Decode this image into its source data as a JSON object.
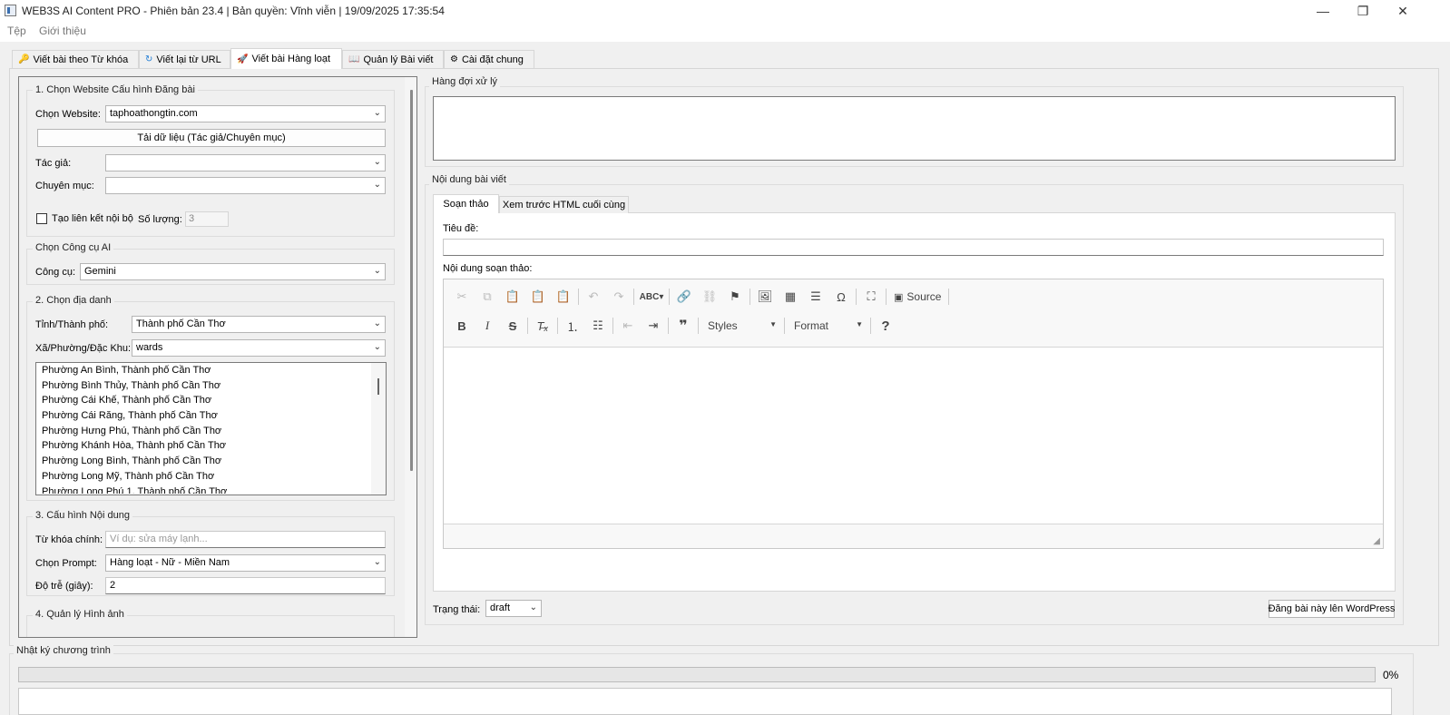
{
  "window": {
    "title": "WEB3S AI Content PRO - Phiên bản 23.4  |  Bản quyền: Vĩnh viễn  |  19/09/2025 17:35:54",
    "minimize": "—",
    "maximize": "❐",
    "close": "✕"
  },
  "menu": {
    "items": [
      "Tệp",
      "Giới thiệu"
    ]
  },
  "tabs": [
    {
      "icon": "🔑",
      "label": "Viết bài theo Từ khóa"
    },
    {
      "icon": "↻",
      "label": "Viết lại từ URL"
    },
    {
      "icon": "🚀",
      "label": "Viết bài Hàng loạt"
    },
    {
      "icon": "📖",
      "label": "Quản lý Bài viết"
    },
    {
      "icon": "⚙",
      "label": "Cài đặt chung"
    }
  ],
  "left": {
    "website_group": {
      "title": "1. Chọn Website  Cấu hình Đăng bài",
      "website_label": "Chọn Website:",
      "website_value": "taphoathongtin.com",
      "load_button": "Tải dữ liệu (Tác giả/Chuyên mục)",
      "author_label": "Tác giả:",
      "author_value": "",
      "category_label": "Chuyên mục:",
      "category_value": "",
      "internal_link_label": "Tạo liên kết nội bộ",
      "internal_link_checked": false,
      "quantity_label": "Số lượng:",
      "quantity_value": "3"
    },
    "ai_group": {
      "title": "Chọn Công cụ AI",
      "tool_label": "Công cụ:",
      "tool_value": "Gemini"
    },
    "place_group": {
      "title": "2. Chọn địa danh",
      "province_label": "Tỉnh/Thành phố:",
      "province_value": "Thành phố Cần Thơ",
      "ward_label": "Xã/Phường/Đặc Khu:",
      "ward_value": "wards",
      "wards": [
        "Phường An Bình, Thành phố Cần Thơ",
        "Phường Bình Thủy, Thành phố Cần Thơ",
        "Phường Cái Khế, Thành phố Cần Thơ",
        "Phường Cái Răng, Thành phố Cần Thơ",
        "Phường Hưng Phú, Thành phố Cần Thơ",
        "Phường Khánh Hòa, Thành phố Cần Thơ",
        "Phường Long Bình, Thành phố Cần Thơ",
        "Phường Long Mỹ, Thành phố Cần Thơ",
        "Phường Long Phú 1, Thành phố Cần Thơ"
      ]
    },
    "content_group": {
      "title": "3. Cấu hình Nội dung",
      "keyword_label": "Từ khóa chính:",
      "keyword_placeholder": "Ví dụ: sửa máy lạnh...",
      "prompt_label": "Chọn Prompt:",
      "prompt_value": "Hàng loạt - Nữ - Miền Nam",
      "delay_label": "Độ trễ (giây):",
      "delay_value": "2"
    },
    "image_group": {
      "title": "4. Quản lý Hình ảnh"
    }
  },
  "queue": {
    "title": "Hàng đợi xử lý"
  },
  "content": {
    "title": "Nội dung bài viết",
    "tabs": [
      "Soạn thảo",
      "Xem trước HTML cuối cùng"
    ],
    "title_label": "Tiêu đề:",
    "title_value": "",
    "editor_label": "Nội dung soạn thảo:",
    "source_label": "Source",
    "styles_label": "Styles",
    "format_label": "Format",
    "status_label": "Trạng thái:",
    "status_value": "draft",
    "post_button": "Đăng bài này lên WordPress"
  },
  "log": {
    "title": "Nhật ký chương trình",
    "progress_percent": 0,
    "progress_text": "0%"
  }
}
